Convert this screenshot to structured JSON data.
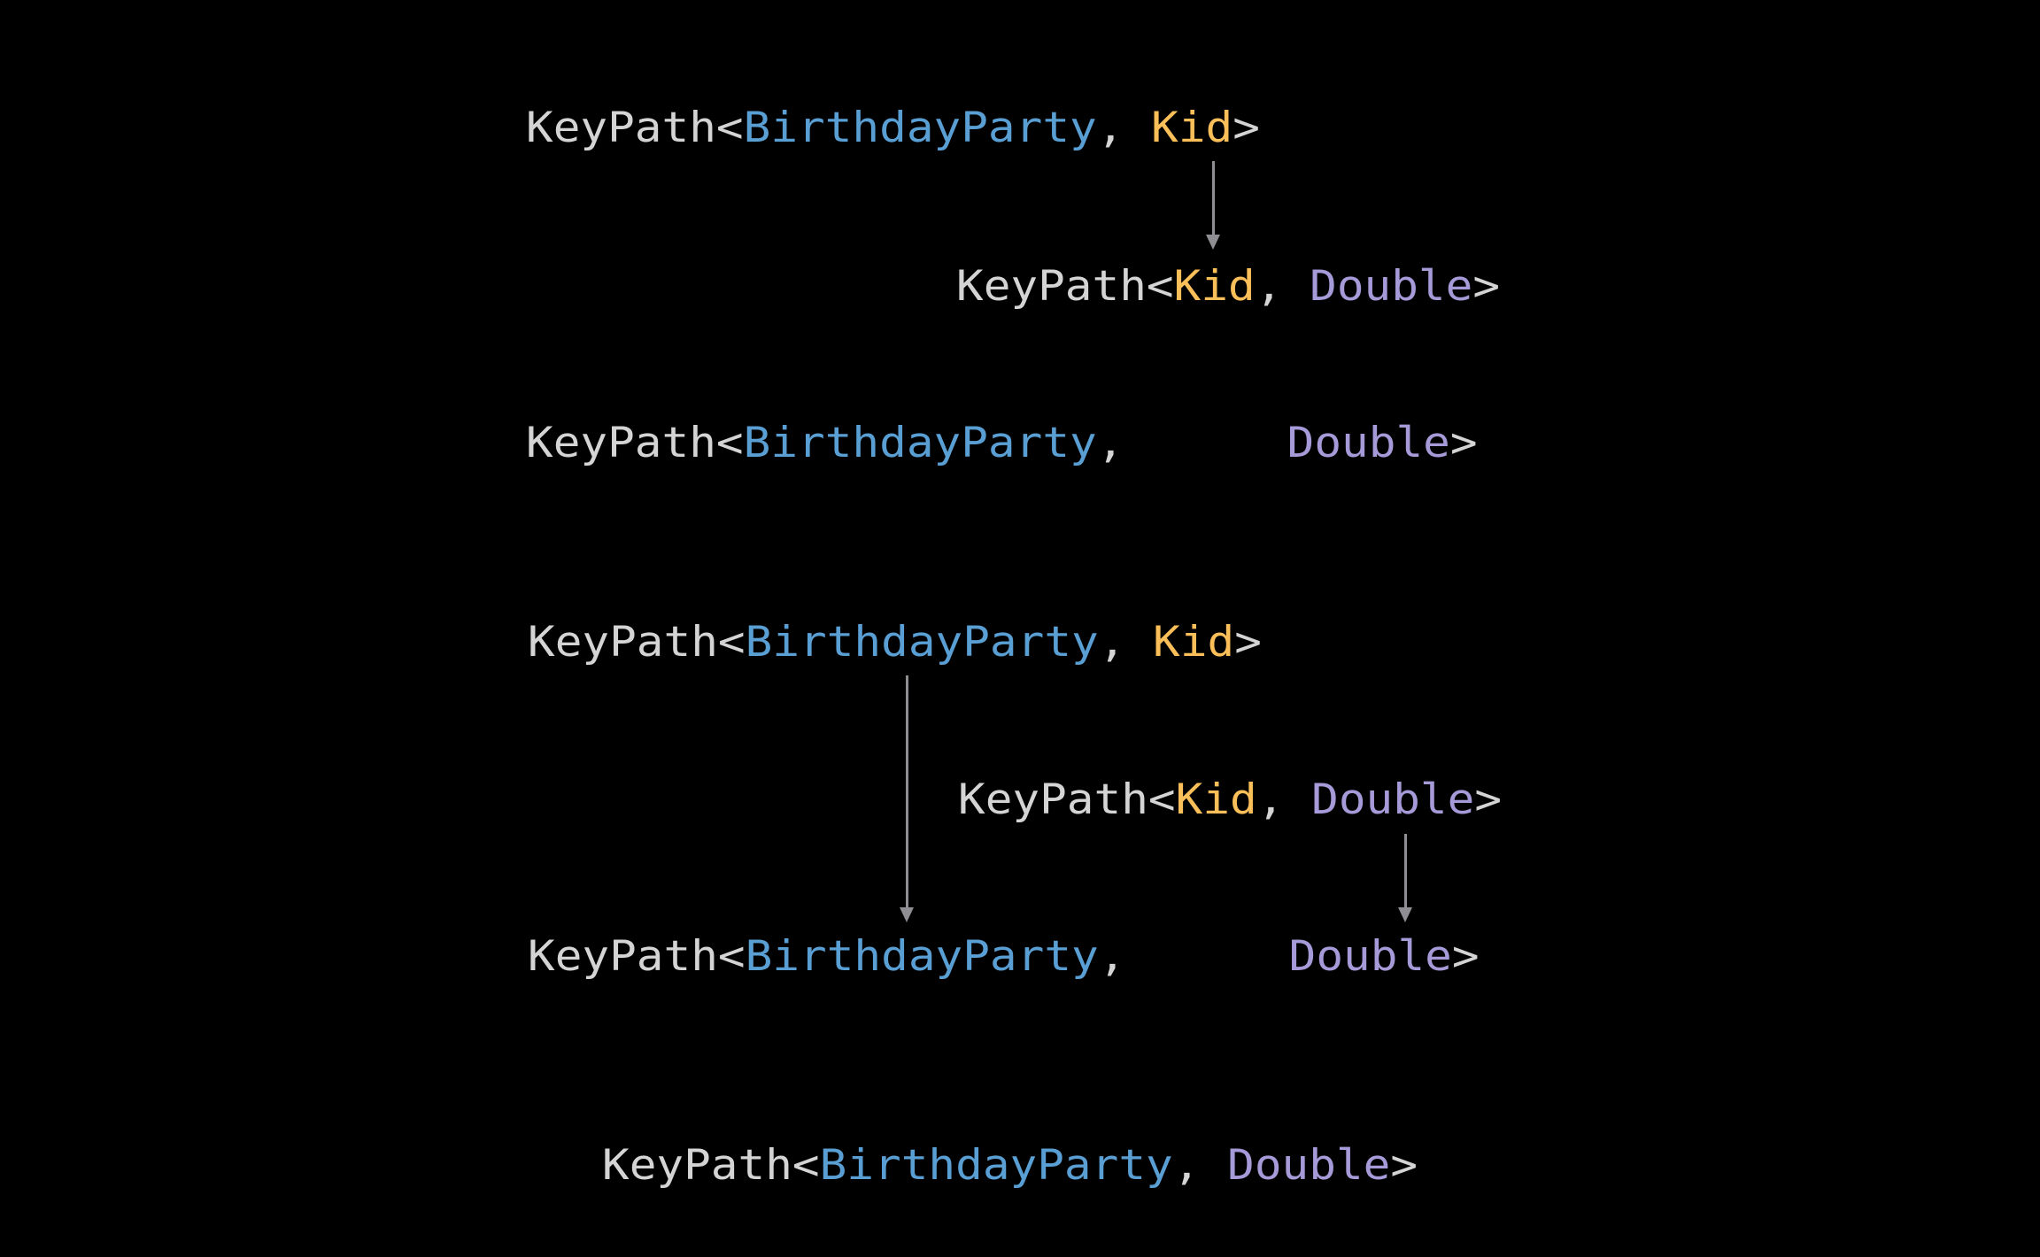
{
  "colors": {
    "background": "#000000",
    "keypath": "#d4d4d4",
    "punct": "#d4d4d4",
    "root": "#5a9fd4",
    "kid": "#fbbf5a",
    "value": "#a79ad9",
    "arrow": "#8e8e93"
  },
  "lines": [
    {
      "id": "ex1-kid-keypath",
      "tokens": [
        {
          "t": "KeyPath<",
          "c": "keypath"
        },
        {
          "t": "BirthdayParty",
          "c": "root"
        },
        {
          "t": ", ",
          "c": "punct"
        },
        {
          "t": "Kid",
          "c": "kid"
        },
        {
          "t": ">",
          "c": "punct"
        }
      ]
    },
    {
      "id": "ex1-double-keypath",
      "tokens": [
        {
          "t": "KeyPath<",
          "c": "keypath"
        },
        {
          "t": "Kid",
          "c": "kid"
        },
        {
          "t": ", ",
          "c": "punct"
        },
        {
          "t": "Double",
          "c": "value"
        },
        {
          "t": ">",
          "c": "punct"
        }
      ]
    },
    {
      "id": "ex1-result",
      "tokens": [
        {
          "t": "KeyPath<",
          "c": "keypath"
        },
        {
          "t": "BirthdayParty",
          "c": "root"
        },
        {
          "t": ",      ",
          "c": "punct"
        },
        {
          "t": "Double",
          "c": "value"
        },
        {
          "t": ">",
          "c": "punct"
        }
      ]
    },
    {
      "id": "ex2-kid-keypath",
      "tokens": [
        {
          "t": "KeyPath<",
          "c": "keypath"
        },
        {
          "t": "BirthdayParty",
          "c": "root"
        },
        {
          "t": ", ",
          "c": "punct"
        },
        {
          "t": "Kid",
          "c": "kid"
        },
        {
          "t": ">",
          "c": "punct"
        }
      ]
    },
    {
      "id": "ex2-double-keypath",
      "tokens": [
        {
          "t": "KeyPath<",
          "c": "keypath"
        },
        {
          "t": "Kid",
          "c": "kid"
        },
        {
          "t": ", ",
          "c": "punct"
        },
        {
          "t": "Double",
          "c": "value"
        },
        {
          "t": ">",
          "c": "punct"
        }
      ]
    },
    {
      "id": "ex2-result",
      "tokens": [
        {
          "t": "KeyPath<",
          "c": "keypath"
        },
        {
          "t": "BirthdayParty",
          "c": "root"
        },
        {
          "t": ",      ",
          "c": "punct"
        },
        {
          "t": "Double",
          "c": "value"
        },
        {
          "t": ">",
          "c": "punct"
        }
      ]
    },
    {
      "id": "final",
      "tokens": [
        {
          "t": "KeyPath<",
          "c": "keypath"
        },
        {
          "t": "BirthdayParty",
          "c": "root"
        },
        {
          "t": ", ",
          "c": "punct"
        },
        {
          "t": "Double",
          "c": "value"
        },
        {
          "t": ">",
          "c": "punct"
        }
      ]
    }
  ]
}
